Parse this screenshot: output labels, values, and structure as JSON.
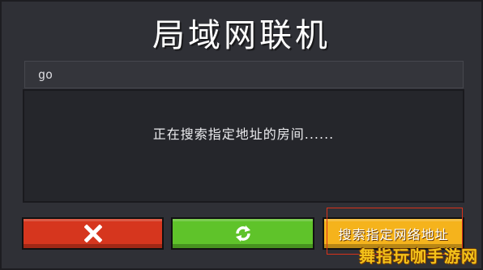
{
  "dialog": {
    "title": "局域网联机",
    "address_value": "go",
    "status_text": "正在搜索指定地址的房间......"
  },
  "buttons": {
    "cancel_icon": "close-icon",
    "refresh_icon": "refresh-icon",
    "search_label": "搜索指定网络地址"
  },
  "watermark": {
    "text": "舞指玩咖手游网"
  },
  "colors": {
    "cancel": "#d6361e",
    "refresh": "#5fc32a",
    "search": "#f5b31c"
  }
}
